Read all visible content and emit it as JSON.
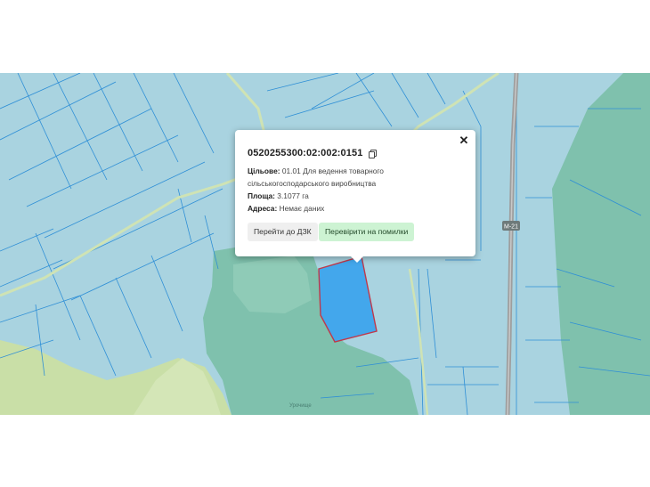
{
  "map": {
    "road_shield": "M-21",
    "place_label": "Урочище",
    "colors": {
      "parcel_fill": "#a9d3e0",
      "parcel_stroke": "#2f8fd6",
      "forest": "#7fc1ad",
      "meadow": "#c9dfa7",
      "selected_parcel": "#43a7ec",
      "selected_outline": "#c0384a",
      "road": "#9e9e9e"
    }
  },
  "popup": {
    "title": "0520255300:02:002:0151",
    "purpose_label": "Цільове:",
    "purpose_value": "01.01 Для ведення товарного сільськогосподарського виробництва",
    "area_label": "Площа:",
    "area_value": "3.1077 га",
    "address_label": "Адреса:",
    "address_value": "Немає даних",
    "btn_dzk": "Перейти до ДЗК",
    "btn_check": "Перевірити на помилки",
    "close": "✕"
  }
}
